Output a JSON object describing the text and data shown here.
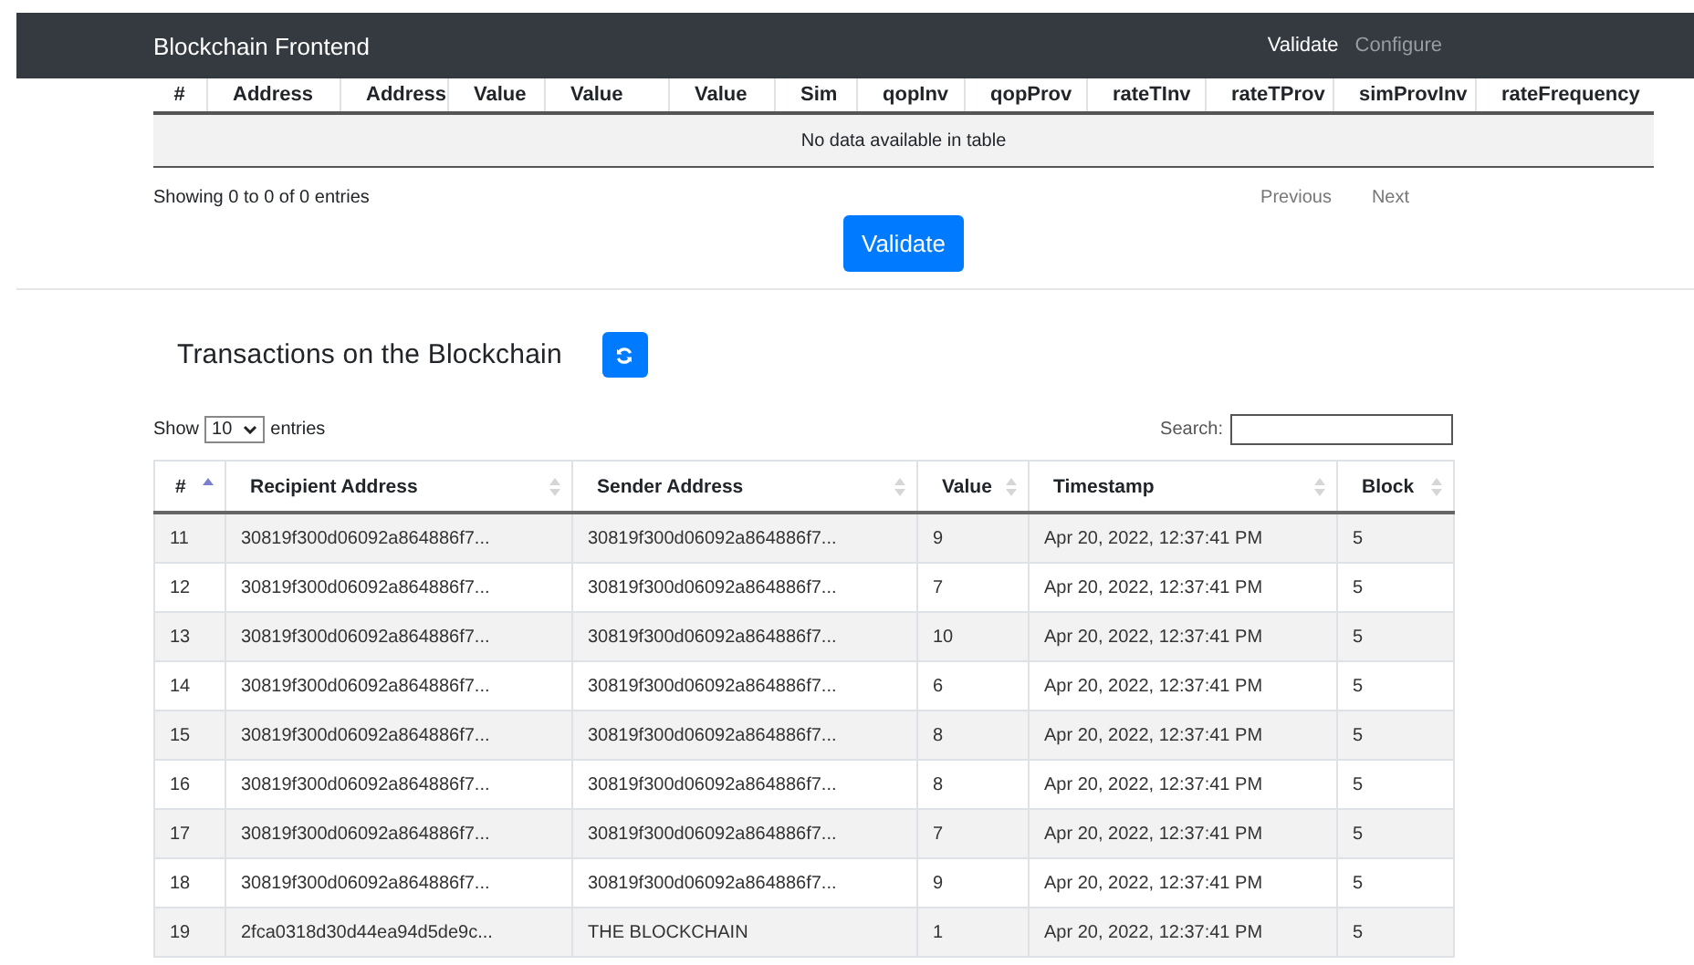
{
  "navbar": {
    "brand": "Blockchain Frontend",
    "links": [
      {
        "label": "Validate",
        "selected": true
      },
      {
        "label": "Configure",
        "selected": false
      }
    ]
  },
  "validation_table": {
    "columns": [
      "#",
      "Address",
      "Address",
      "Value",
      "Value",
      "Value",
      "Sim",
      "qopInv",
      "qopProv",
      "rateTInv",
      "rateTProv",
      "simProvInv",
      "rateFrequency"
    ],
    "empty_message": "No data available in table",
    "info": "Showing 0 to 0 of 0 entries",
    "pagination": [
      "Previous",
      "Next"
    ]
  },
  "validate_button": "Validate",
  "transactions": {
    "title": "Transactions on the Blockchain",
    "length_label_before": "Show",
    "length_value": "10",
    "length_label_after": "entries",
    "search_label": "Search:",
    "columns": [
      {
        "label": "#",
        "sorted": true
      },
      {
        "label": "Recipient Address",
        "sorted": false
      },
      {
        "label": "Sender Address",
        "sorted": false
      },
      {
        "label": "Value",
        "sorted": false
      },
      {
        "label": "Timestamp",
        "sorted": false
      },
      {
        "label": "Block",
        "sorted": false
      }
    ],
    "rows": [
      [
        "11",
        "30819f300d06092a864886f7...",
        "30819f300d06092a864886f7...",
        "9",
        "Apr 20, 2022, 12:37:41 PM",
        "5"
      ],
      [
        "12",
        "30819f300d06092a864886f7...",
        "30819f300d06092a864886f7...",
        "7",
        "Apr 20, 2022, 12:37:41 PM",
        "5"
      ],
      [
        "13",
        "30819f300d06092a864886f7...",
        "30819f300d06092a864886f7...",
        "10",
        "Apr 20, 2022, 12:37:41 PM",
        "5"
      ],
      [
        "14",
        "30819f300d06092a864886f7...",
        "30819f300d06092a864886f7...",
        "6",
        "Apr 20, 2022, 12:37:41 PM",
        "5"
      ],
      [
        "15",
        "30819f300d06092a864886f7...",
        "30819f300d06092a864886f7...",
        "8",
        "Apr 20, 2022, 12:37:41 PM",
        "5"
      ],
      [
        "16",
        "30819f300d06092a864886f7...",
        "30819f300d06092a864886f7...",
        "8",
        "Apr 20, 2022, 12:37:41 PM",
        "5"
      ],
      [
        "17",
        "30819f300d06092a864886f7...",
        "30819f300d06092a864886f7...",
        "7",
        "Apr 20, 2022, 12:37:41 PM",
        "5"
      ],
      [
        "18",
        "30819f300d06092a864886f7...",
        "30819f300d06092a864886f7...",
        "9",
        "Apr 20, 2022, 12:37:41 PM",
        "5"
      ],
      [
        "19",
        "2fca0318d30d44ea94d5de9c...",
        "THE BLOCKCHAIN",
        "1",
        "Apr 20, 2022, 12:37:41 PM",
        "5"
      ]
    ]
  }
}
